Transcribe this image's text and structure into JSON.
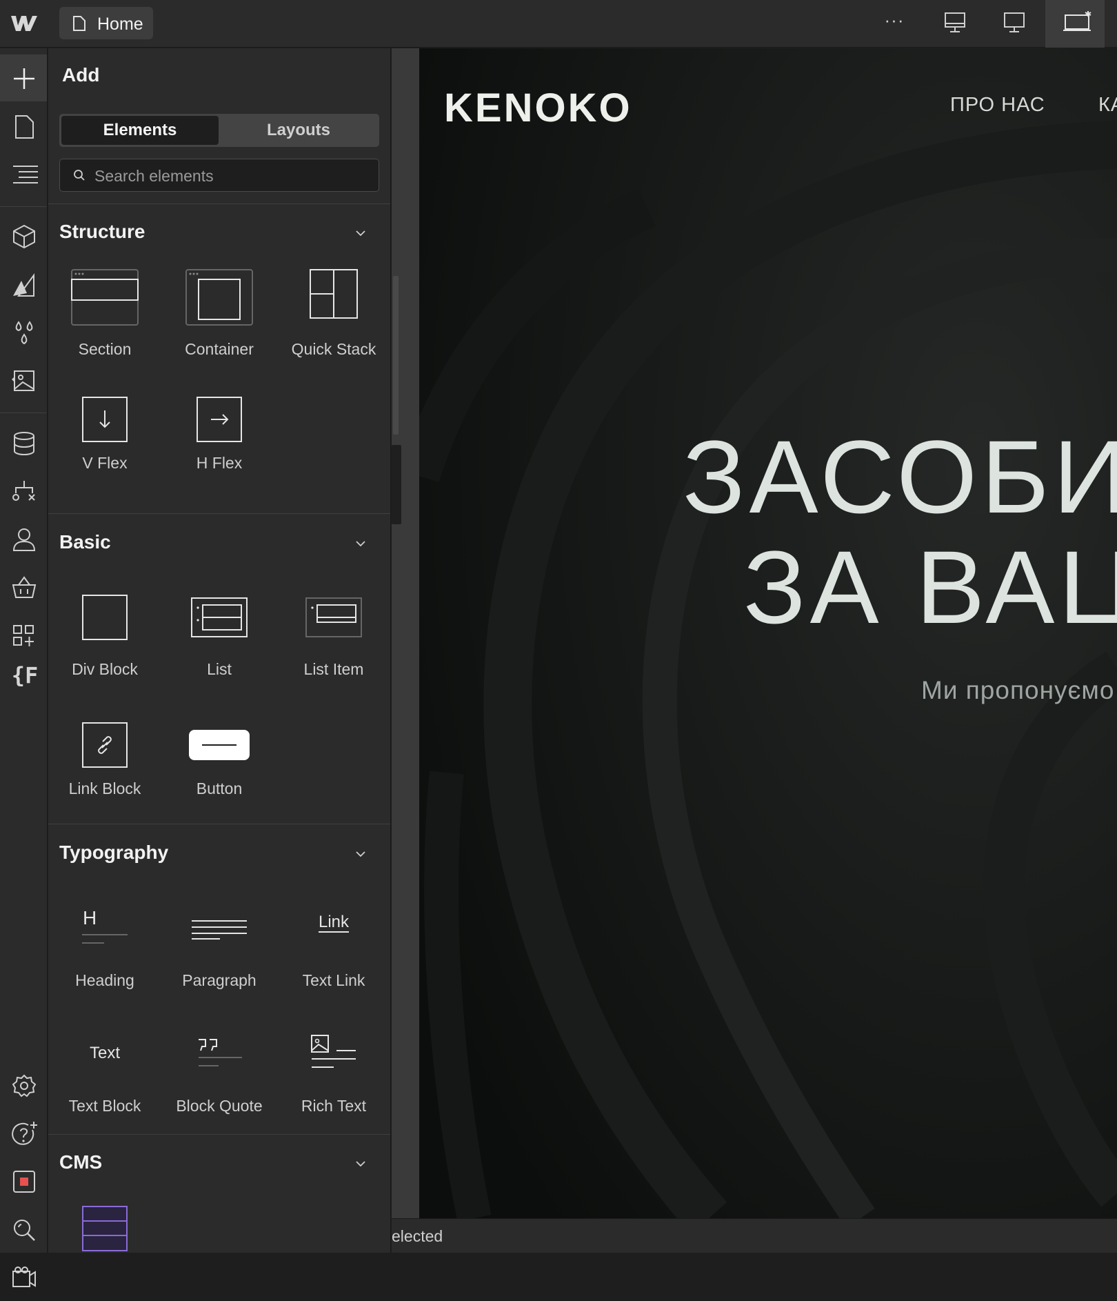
{
  "topbar": {
    "page_name": "Home",
    "more_label": "···"
  },
  "add_panel": {
    "title": "Add",
    "tabs": [
      "Elements",
      "Layouts"
    ],
    "search_placeholder": "Search elements",
    "sections": {
      "structure": {
        "title": "Structure",
        "items": [
          "Section",
          "Container",
          "Quick Stack",
          "V Flex",
          "H Flex"
        ]
      },
      "basic": {
        "title": "Basic",
        "items": [
          "Div Block",
          "List",
          "List Item",
          "Link Block",
          "Button"
        ]
      },
      "typography": {
        "title": "Typography",
        "items": [
          "Heading",
          "Paragraph",
          "Text Link",
          "Text Block",
          "Block Quote",
          "Rich Text"
        ],
        "heading_glyph": "H",
        "link_glyph": "Link",
        "text_glyph": "Text"
      },
      "cms": {
        "title": "CMS"
      }
    }
  },
  "rail": {
    "variables_glyph": "{F"
  },
  "site": {
    "logo": "KENOKO",
    "nav": [
      "ПРО НАС",
      "КА"
    ],
    "hero_line1": "ЗАСОБИ",
    "hero_line2": "ЗА ВАЦ",
    "subtitle": "Ми пропонуємо"
  },
  "status": {
    "text": "elected"
  }
}
